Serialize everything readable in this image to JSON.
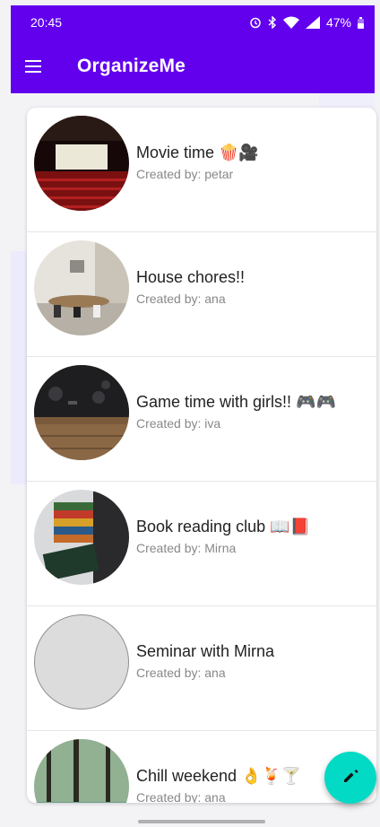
{
  "status_bar": {
    "time": "20:45",
    "battery": "47%"
  },
  "app_bar": {
    "title": "OrganizeMe"
  },
  "events": [
    {
      "title": "Movie time 🍿🎥",
      "created_by": "Created by: petar"
    },
    {
      "title": "House chores!!",
      "created_by": "Created by: ana"
    },
    {
      "title": "Game time with girls!! 🎮🎮",
      "created_by": "Created by: iva"
    },
    {
      "title": "Book reading club 📖📕",
      "created_by": "Created by: Mirna"
    },
    {
      "title": "Seminar with Mirna",
      "created_by": "Created by: ana"
    },
    {
      "title": "Chill weekend 👌🍹🍸",
      "created_by": "Created by: ana"
    }
  ],
  "colors": {
    "primary": "#6200ee",
    "fab": "#03dac5"
  }
}
